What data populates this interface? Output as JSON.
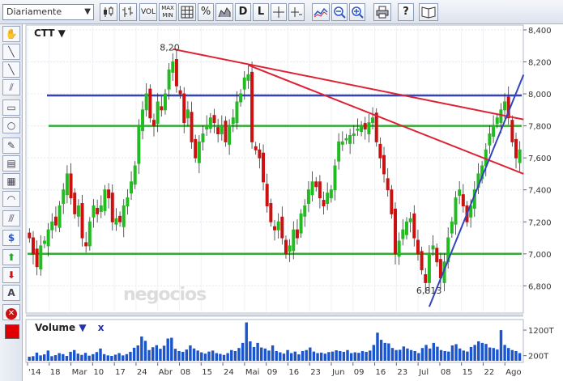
{
  "toolbar": {
    "period": "Diariamente",
    "vol_label": "VOL",
    "maxmin_top": "MAX",
    "maxmin_bottom": "MIN",
    "pct_label": "%",
    "d_label": "D",
    "l_label": "L",
    "help_label": "?"
  },
  "ticker_label": "CTT ▼",
  "watermark": "negocios",
  "volume_panel": {
    "label": "Volume",
    "dropdown": "▼",
    "close": "x"
  },
  "colors": {
    "up": "#22bb22",
    "down": "#cc1111",
    "blue_line": "#3344bb",
    "green_line": "#33aa33",
    "red_line": "#dd2233",
    "volume_bar": "#1a55cc",
    "swatch": "#e00000"
  },
  "chart_data": {
    "type": "candlestick",
    "y_ticks": [
      "8,400",
      "8,200",
      "8,000",
      "7,800",
      "7,600",
      "7,400",
      "7,200",
      "7,000",
      "6,800"
    ],
    "y_values": [
      8.4,
      8.2,
      8.0,
      7.8,
      7.6,
      7.4,
      7.2,
      7.0,
      6.8
    ],
    "ylim": [
      6.64,
      8.42
    ],
    "x_ticks": [
      "'14",
      "18",
      "Mar",
      "10",
      "17",
      "24",
      "Abr",
      "08",
      "15",
      "24",
      "Mai",
      "09",
      "16",
      "23",
      "Jun",
      "09",
      "16",
      "23",
      "Jul",
      "08",
      "15",
      "22",
      "Ago"
    ],
    "annotations": [
      {
        "text": "8,20",
        "value": 8.2
      },
      {
        "text": "6,813",
        "value": 6.813
      }
    ],
    "horizontal_lines": [
      {
        "color": "blue",
        "value": 7.99
      },
      {
        "color": "green",
        "value": 7.8
      },
      {
        "color": "green",
        "value": 7.0
      }
    ],
    "close": [
      7.1,
      7.0,
      6.92,
      7.05,
      7.08,
      7.15,
      7.2,
      7.18,
      7.3,
      7.4,
      7.5,
      7.35,
      7.25,
      7.3,
      7.1,
      7.05,
      7.2,
      7.3,
      7.25,
      7.3,
      7.4,
      7.35,
      7.2,
      7.22,
      7.2,
      7.3,
      7.35,
      7.45,
      7.55,
      7.8,
      7.9,
      8.0,
      7.85,
      7.8,
      7.95,
      7.9,
      8.0,
      8.15,
      8.2,
      8.05,
      8.0,
      7.82,
      7.9,
      7.7,
      7.6,
      7.7,
      7.75,
      7.8,
      7.85,
      7.82,
      7.75,
      7.8,
      7.7,
      7.8,
      7.85,
      7.95,
      8.0,
      8.1,
      8.12,
      7.7,
      7.65,
      7.6,
      7.45,
      7.3,
      7.2,
      7.15,
      7.2,
      7.1,
      7.0,
      7.05,
      7.15,
      7.1,
      7.25,
      7.3,
      7.4,
      7.45,
      7.42,
      7.35,
      7.3,
      7.38,
      7.4,
      7.55,
      7.7,
      7.7,
      7.72,
      7.74,
      7.75,
      7.78,
      7.8,
      7.78,
      7.82,
      7.85,
      7.7,
      7.6,
      7.5,
      7.4,
      7.25,
      7.0,
      7.08,
      7.15,
      7.2,
      7.22,
      7.1,
      7.0,
      6.9,
      6.82,
      7.0,
      7.05,
      6.95,
      6.85,
      6.95,
      7.1,
      7.2,
      7.35,
      7.4,
      7.3,
      7.2,
      7.3,
      7.4,
      7.5,
      7.55,
      7.65,
      7.75,
      7.8,
      7.85,
      7.9,
      7.95,
      7.85,
      7.7,
      7.6,
      7.65
    ],
    "volume_ticks": [
      "1200T",
      "200T"
    ],
    "volume": [
      160,
      180,
      320,
      210,
      250,
      400,
      180,
      220,
      300,
      260,
      190,
      350,
      420,
      280,
      230,
      310,
      200,
      260,
      340,
      480,
      260,
      210,
      190,
      240,
      300,
      210,
      260,
      350,
      510,
      600,
      950,
      780,
      420,
      530,
      610,
      470,
      590,
      870,
      900,
      470,
      380,
      350,
      440,
      600,
      480,
      400,
      330,
      280,
      360,
      400,
      300,
      270,
      230,
      300,
      420,
      380,
      500,
      700,
      1500,
      760,
      540,
      700,
      520,
      480,
      400,
      600,
      380,
      330,
      280,
      420,
      300,
      360,
      250,
      380,
      420,
      520,
      360,
      300,
      320,
      280,
      340,
      360,
      410,
      380,
      350,
      420,
      300,
      330,
      310,
      380,
      350,
      400,
      620,
      1100,
      820,
      700,
      680,
      500,
      420,
      430,
      560,
      480,
      420,
      380,
      300,
      500,
      620,
      480,
      700,
      550,
      420,
      380,
      360,
      600,
      650,
      480,
      400,
      360,
      540,
      620,
      760,
      700,
      660,
      520,
      500,
      440,
      1200,
      620,
      500,
      420,
      380,
      300
    ]
  }
}
